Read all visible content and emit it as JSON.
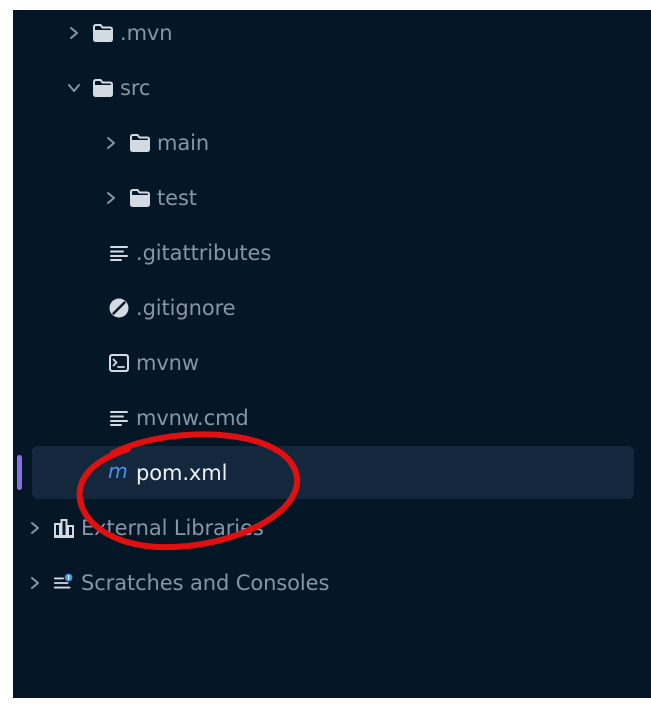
{
  "tree": {
    "items": [
      {
        "label": ".mvn",
        "icon": "folder-icon",
        "chevron": "collapsed"
      },
      {
        "label": "src",
        "icon": "folder-icon",
        "chevron": "expanded"
      },
      {
        "label": "main",
        "icon": "folder-icon",
        "chevron": "collapsed"
      },
      {
        "label": "test",
        "icon": "folder-icon",
        "chevron": "collapsed"
      },
      {
        "label": ".gitattributes",
        "icon": "text-file-icon"
      },
      {
        "label": ".gitignore",
        "icon": "ignore-file-icon"
      },
      {
        "label": "mvnw",
        "icon": "shell-script-icon"
      },
      {
        "label": "mvnw.cmd",
        "icon": "text-file-icon"
      },
      {
        "label": "pom.xml",
        "icon": "maven-icon",
        "selected": true
      },
      {
        "label": "External Libraries",
        "icon": "library-icon",
        "chevron": "collapsed"
      },
      {
        "label": "Scratches and Consoles",
        "icon": "scratches-icon",
        "chevron": "collapsed"
      }
    ]
  },
  "colors": {
    "panel_background": "#051726",
    "selection_background": "#13283d",
    "selection_marker": "#8a6fe0",
    "maven_icon": "#4a8ef0",
    "annotation_circle": "#e01010"
  }
}
